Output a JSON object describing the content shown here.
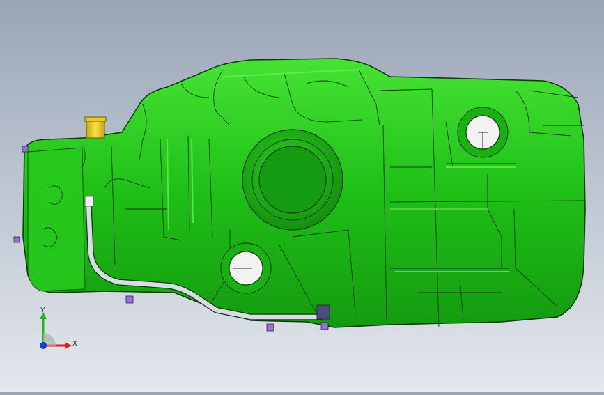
{
  "viewport": {
    "background_top": "#9aa5b6",
    "background_bottom": "#e4e7ec",
    "model": {
      "name": "fuel-tank",
      "body_color": "#1fbf17",
      "body_highlight": "#6df25a",
      "edge_color": "#0b3d08",
      "filler_cap_color": "#f2d21e",
      "pipe_color": "#d8dde3",
      "fastener_color": "#9b6fd6",
      "port_color": "#f2f2f2"
    }
  },
  "triad": {
    "x_label": "X",
    "y_label": "Y",
    "x_color": "#e0201a",
    "y_color": "#1fb61f",
    "z_color": "#1a3be0"
  }
}
